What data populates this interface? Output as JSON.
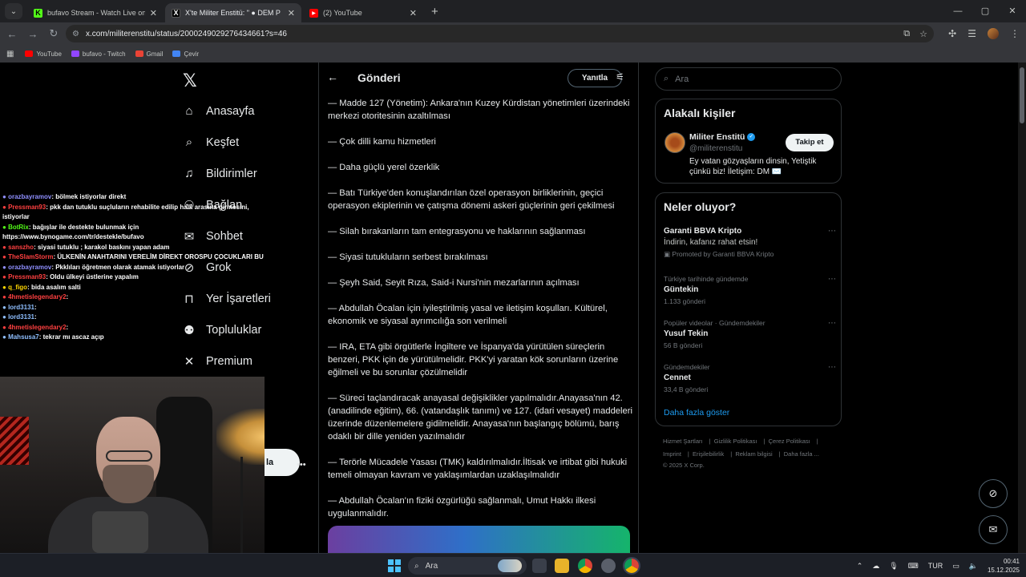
{
  "browser": {
    "tabs": [
      {
        "title": "bufavo Stream - Watch Live on",
        "fav_color": "#53fc18",
        "fav_letter": "K"
      },
      {
        "title": "X'te Militer Enstitü: \" ● DEM P",
        "fav_color": "#000000",
        "fav_letter": "X"
      },
      {
        "title": "(2) YouTube",
        "fav_color": "#ff0000",
        "fav_letter": "▶"
      }
    ],
    "url": "x.com/militerenstitu/status/2000249029276434661?s=46",
    "bookmarks": [
      {
        "label": "YouTube",
        "color": "#ff0000"
      },
      {
        "label": "bufavo - Twitch",
        "color": "#9146ff"
      },
      {
        "label": "Gmail",
        "color": "#ea4335"
      },
      {
        "label": "Çevir",
        "color": "#4285f4"
      }
    ]
  },
  "nav": {
    "items": [
      {
        "label": "Anasayfa",
        "icon": "home-icon"
      },
      {
        "label": "Keşfet",
        "icon": "search-icon"
      },
      {
        "label": "Bildirimler",
        "icon": "bell-icon"
      },
      {
        "label": "Bağlan",
        "icon": "add-user-icon"
      },
      {
        "label": "Sohbet",
        "icon": "mail-icon"
      },
      {
        "label": "Grok",
        "icon": "grok-icon"
      },
      {
        "label": "Yer İşaretleri",
        "icon": "bookmark-icon"
      },
      {
        "label": "Topluluklar",
        "icon": "communities-icon"
      },
      {
        "label": "Premium",
        "icon": "x-icon"
      }
    ],
    "post_button_partial": "la"
  },
  "post": {
    "header_title": "Gönderi",
    "reply_label": "Yanıtla",
    "paragraphs": [
      "— Madde 127 (Yönetim): Ankara'nın Kuzey Kürdistan yönetimleri üzerindeki merkezi otoritesinin azaltılması",
      "— Çok dilli kamu hizmetleri",
      "— Daha güçlü yerel özerklik",
      "— Batı Türkiye'den konuşlandırılan özel operasyon birliklerinin, geçici operasyon ekiplerinin ve çatışma dönemi askeri güçlerinin geri çekilmesi",
      "— Silah bırakanların tam entegrasyonu ve haklarının sağlanması",
      "— Siyasi tutukluların serbest bırakılması",
      "— Şeyh Said, Seyit Rıza, Said-i Nursi'nin mezarlarının açılması",
      "— Abdullah Öcalan için iyileştirilmiş yasal ve iletişim koşulları. Kültürel, ekonomik ve siyasal ayrımcılığa son verilmeli",
      "— IRA, ETA gibi örgütlerle İngiltere ve İspanya'da yürütülen süreçlerin benzeri, PKK için de yürütülmelidir. PKK'yi yaratan kök sorunların üzerine eğilmeli ve bu sorunlar çözülmelidir",
      "— Süreci taçlandıracak anayasal değişiklikler yapılmalıdır.Anayasa'nın 42. (anadilinde eğitim), 66. (vatandaşlık tanımı) ve 127. (idari vesayet) maddeleri üzerinde düzenlemelere gidilmelidir. Anayasa'nın başlangıç bölümü, barış odaklı bir dille yeniden yazılmalıdır",
      "— Terörle Mücadele Yasası (TMK) kaldırılmalıdır.İltisak ve irtibat gibi hukuki temeli olmayan kavram ve yaklaşımlardan uzaklaşılmalıdır",
      "— Abdullah Öcalan'ın fiziki özgürlüğü sağlanmalı, Umut Hakkı ilkesi uygulanmalıdır."
    ]
  },
  "sidebar": {
    "search_placeholder": "Ara",
    "relevant_title": "Alakalı kişiler",
    "person": {
      "name": "Militer Enstitü",
      "handle": "@militerenstitu",
      "follow_label": "Takip et",
      "bio": "Ey vatan gözyaşların dinsin, Yetiştik çünkü biz! İletişim: DM ✉️"
    },
    "trends_title": "Neler oluyor?",
    "trends": [
      {
        "context": "",
        "name": "Garanti BBVA Kripto",
        "sub": "İndirin, kafanız rahat etsin!",
        "count": "Promoted by Garanti BBVA Kripto"
      },
      {
        "context": "Türkiye tarihinde gündemde",
        "name": "Güntekin",
        "sub": "",
        "count": "1.133 gönderi"
      },
      {
        "context": "Popüler videolar · Gündemdekiler",
        "name": "Yusuf Tekin",
        "sub": "",
        "count": "56 B gönderi"
      },
      {
        "context": "Gündemdekiler",
        "name": "Cennet",
        "sub": "",
        "count": "33,4 B gönderi"
      }
    ],
    "show_more": "Daha fazla göster",
    "footer_row1": [
      "Hizmet Şartları",
      "Gizlilik Politikası",
      "Çerez Politikası"
    ],
    "footer_row2": [
      "Imprint",
      "Erişilebilirlik",
      "Reklam bilgisi",
      "Daha fazla ..."
    ],
    "copyright": "© 2025 X Corp."
  },
  "stream_chat": [
    {
      "user": "orazbayramov",
      "msg": ": bölmek istiyorlar direkt",
      "color": "#8f8fff"
    },
    {
      "user": "Pressman93",
      "msg": ": pkk dan tutuklu suçluların rehabilite edilip halk arasına girmesini, istiyorlar",
      "color": "#ff4040"
    },
    {
      "user": "BotRix",
      "msg": ": bağışlar ile destekte bulunmak için https://www.bynogame.com/tr/destekle/bufavo",
      "color": "#53fc18"
    },
    {
      "user": "sanszho",
      "msg": ": siyasi tutuklu ; karakol baskını yapan adam",
      "color": "#ff4040"
    },
    {
      "user": "TheSlamStorm",
      "msg": ": ÜLKENİN ANAHTARINI VERELİM DİREKT OROSPU ÇOCUKLARI BU NE AMK",
      "color": "#ff4040"
    },
    {
      "user": "orazbayramov",
      "msg": ": Pkklıları öğretmen olarak atamak istiyorlar",
      "color": "#8f8fff"
    },
    {
      "user": "Pressman93",
      "msg": ": Oldu ülkeyi üstlerine yapalım",
      "color": "#ff4040"
    },
    {
      "user": "q_figo",
      "msg": ": bida asalım salti",
      "color": "#ffd700"
    },
    {
      "user": "4hmetislegendary2",
      "msg": ":",
      "color": "#ff4040"
    },
    {
      "user": "lord3131",
      "msg": ":",
      "color": "#8fbfff"
    },
    {
      "user": "lord3131",
      "msg": ":",
      "color": "#8fbfff"
    },
    {
      "user": "4hmetislegendary2",
      "msg": ":",
      "color": "#ff4040"
    },
    {
      "user": "Mahsusa7",
      "msg": ": tekrar mı ascaz açıp",
      "color": "#8fbfff"
    }
  ],
  "taskbar": {
    "search_label": "Ara",
    "lang": "TUR",
    "time": "00:41",
    "date": "15.12.2025"
  }
}
